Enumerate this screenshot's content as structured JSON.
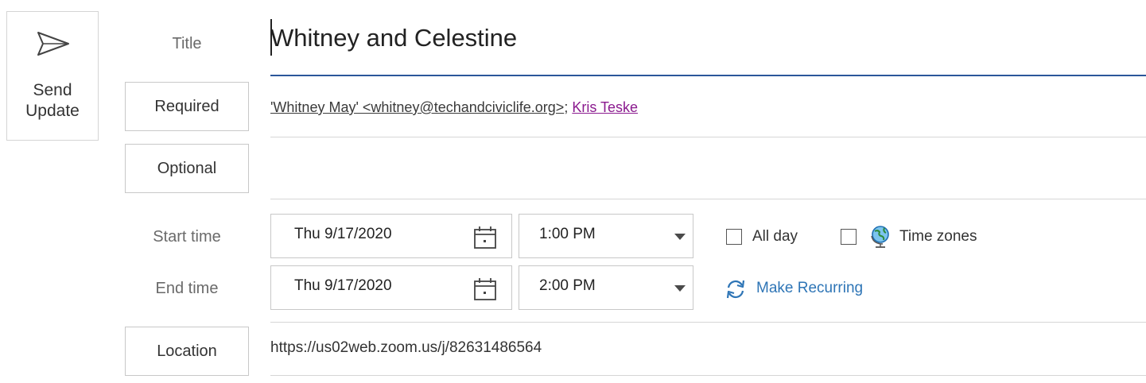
{
  "toolbar": {
    "send_update_line1": "Send",
    "send_update_line2": "Update"
  },
  "title": {
    "label": "Title",
    "value": "Whitney and Celestine"
  },
  "required": {
    "label": "Required",
    "recipients": [
      "'Whitney May' <whitney@techandciviclife.org>",
      "Kris Teske"
    ],
    "separator": ";"
  },
  "optional": {
    "label": "Optional",
    "value": ""
  },
  "start": {
    "label": "Start time",
    "date": "Thu 9/17/2020",
    "time": "1:00 PM"
  },
  "end": {
    "label": "End time",
    "date": "Thu 9/17/2020",
    "time": "2:00 PM"
  },
  "options": {
    "all_day_label": "All day",
    "all_day_checked": false,
    "time_zones_label": "Time zones",
    "time_zones_checked": false,
    "make_recurring_label": "Make Recurring"
  },
  "location": {
    "label": "Location",
    "value": "https://us02web.zoom.us/j/82631486564"
  },
  "colors": {
    "title_underline": "#2b579a",
    "link": "#2e75b6",
    "resolved_contact": "#8b1b8f"
  },
  "icons": [
    "send-icon",
    "calendar-icon",
    "dropdown-arrow-icon",
    "globe-icon",
    "recurring-icon"
  ]
}
